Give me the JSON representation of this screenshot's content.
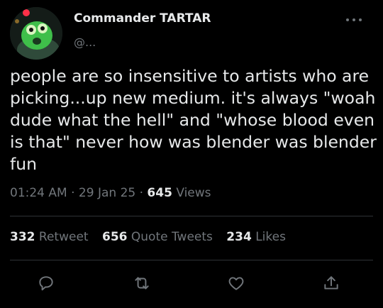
{
  "author": {
    "display_name": "Commander TARTAR",
    "handle": "@..."
  },
  "more_icon": "more-horizontal-icon",
  "tweet_text": "people are so insensitive to artists who are picking...up new medium. it's always \"woah dude what the hell\" and \"whose blood even is that\" never how was blender was blender fun",
  "meta": {
    "time": "01:24 AM",
    "separator": "·",
    "date": "29 Jan 25",
    "views_count": "645",
    "views_label": "Views"
  },
  "stats": {
    "retweets_count": "332",
    "retweets_label": "Retweet",
    "quotes_count": "656",
    "quotes_label": "Quote Tweets",
    "likes_count": "234",
    "likes_label": "Likes"
  },
  "actions": [
    "reply-icon",
    "retweet-icon",
    "like-icon",
    "share-icon"
  ],
  "colors": {
    "background": "#000000",
    "text_primary": "#e7e9ea",
    "text_secondary": "#71767b",
    "divider": "#2f3336"
  }
}
